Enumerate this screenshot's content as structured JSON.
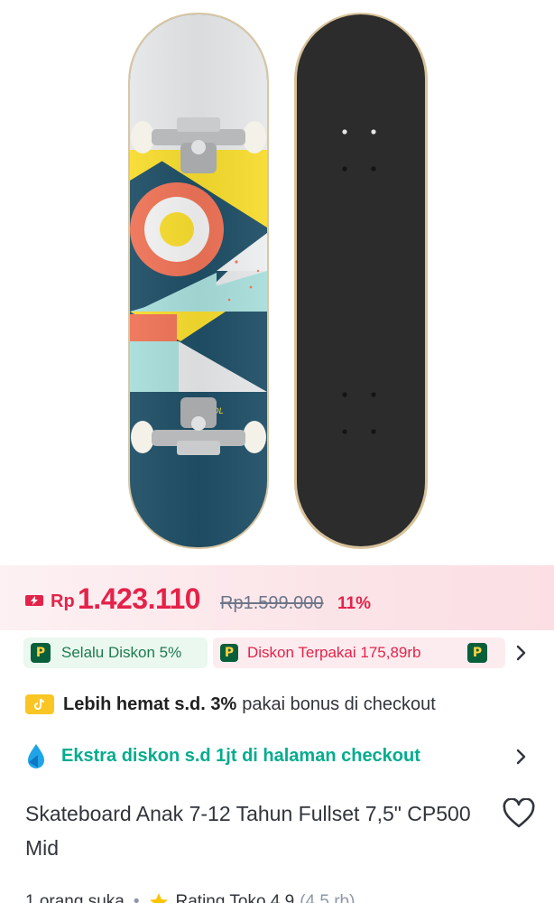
{
  "product_image": {
    "graphic_text": "SDL"
  },
  "price": {
    "currency": "Rp",
    "value": "1.423.110",
    "original": "Rp1.599.000",
    "discount_pct": "11%"
  },
  "promos": {
    "chip_1": "Selalu Diskon 5%",
    "chip_2": "Diskon Terpakai 175,89rb",
    "logo_letter": "P"
  },
  "bonus": {
    "bold": "Lebih hemat s.d. 3%",
    "rest": "pakai bonus di checkout"
  },
  "ekstra": {
    "text": "Ekstra diskon s.d 1jt di halaman checkout"
  },
  "product": {
    "title": "Skateboard Anak 7-12 Tahun Fullset 7,5\" CP500 Mid"
  },
  "meta": {
    "likes": "1 orang suka",
    "separator": "•",
    "rating_label": "Rating Toko 4,9",
    "rating_count": "(4,5 rb)"
  },
  "colors": {
    "price_red": "#e4234a",
    "tokopedia_green": "#03ac8e",
    "deck_teal": "#1f4f66",
    "deck_yellow": "#f7dc2e",
    "deck_coral": "#ee7357",
    "deck_mint": "#a8dedb",
    "bottom_deck": "#2c2c2c"
  },
  "icons": {
    "flash_sale": "flash-sale-icon",
    "bonus": "tiktok-bonus-icon",
    "ekstra": "discount-drop-icon",
    "heart": "heart-outline-icon",
    "star": "star-icon"
  }
}
